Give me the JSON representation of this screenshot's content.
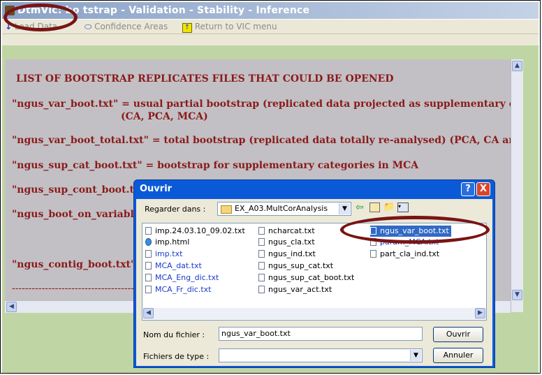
{
  "window": {
    "title": "DtmVic: bootstrap - Validation - Stability - Inference",
    "title_visible": "DtmVic: bo    tstrap - Validation - Stability - Inference"
  },
  "menubar": {
    "load_data": "Load Data",
    "confidence_areas": "Confidence Areas",
    "return_vic": "Return to VIC menu"
  },
  "document": {
    "heading": "LIST  OF  BOOTSTRAP  REPLICATES  FILES  THAT  COULD  BE  OPENED",
    "lines": [
      "\"ngus_var_boot.txt\"  =  usual partial bootstrap  (replicated data projected as supplementary elements)",
      "(CA, PCA, MCA)",
      "\"ngus_var_boot_total.txt\"  =  total bootstrap (replicated data totally re-analysed) (PCA, CA and MCA)",
      "\"ngus_sup_cat_boot.txt\" = bootstrap for supplementary categories in MCA",
      "\"ngus_sup_cont_boot.txt",
      "\"ngus_boot_on_variables",
      "\"ngus_contig_boot.txt\"  =",
      "----------------------------------------------"
    ]
  },
  "dialog": {
    "title": "Ouvrir",
    "help": "?",
    "close": "X",
    "look_in_label": "Regarder dans :",
    "look_in_value": "EX_A03.MultCorAnalysis",
    "files": [
      {
        "name": "imp.24.03.10_09.02.txt",
        "style": "normal"
      },
      {
        "name": "imp.html",
        "style": "html"
      },
      {
        "name": "imp.txt",
        "style": "blue"
      },
      {
        "name": "MCA_dat.txt",
        "style": "blue"
      },
      {
        "name": "MCA_Eng_dic.txt",
        "style": "blue"
      },
      {
        "name": "MCA_Fr_dic.txt",
        "style": "blue"
      },
      {
        "name": "ncharcat.txt",
        "style": "normal"
      },
      {
        "name": "ngus_cla.txt",
        "style": "normal"
      },
      {
        "name": "ngus_ind.txt",
        "style": "normal"
      },
      {
        "name": "ngus_sup_cat.txt",
        "style": "normal"
      },
      {
        "name": "ngus_sup_cat_boot.txt",
        "style": "normal"
      },
      {
        "name": "ngus_var_act.txt",
        "style": "normal"
      },
      {
        "name": "ngus_var_boot.txt",
        "style": "selected"
      },
      {
        "name": "param_MCA.txt",
        "style": "blue"
      },
      {
        "name": "part_cla_ind.txt",
        "style": "normal"
      }
    ],
    "filename_label": "Nom du fichier :",
    "filename_value": "ngus_var_boot.txt",
    "filetype_label": "Fichiers de type :",
    "filetype_value": "",
    "open_button": "Ouvrir",
    "cancel_button": "Annuler"
  },
  "colors": {
    "title_bar": "#8aa2c6",
    "doc_text": "#8a1a1a",
    "dialog_title": "#0a5ad8",
    "highlight_ellipse": "#7a1414",
    "selection": "#316ac5"
  }
}
